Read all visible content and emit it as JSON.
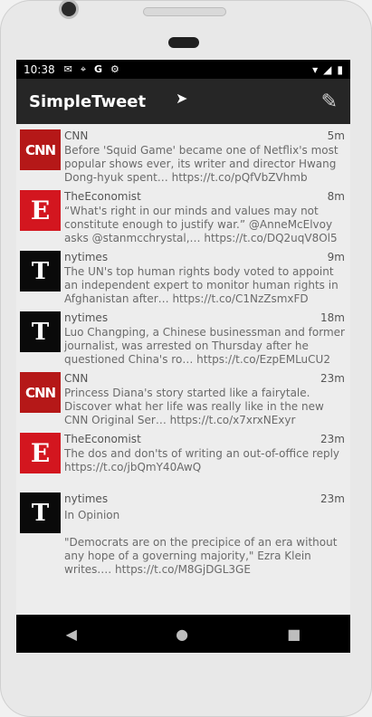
{
  "status": {
    "time": "10:38"
  },
  "appbar": {
    "title": "SimpleTweet"
  },
  "tweets": [
    {
      "user": "CNN",
      "avatar": "CNN",
      "age": "5m",
      "text": "Before 'Squid Game' became one of Netflix's most popular shows ever, its writer and director Hwang Dong-hyuk spent… https://t.co/pQfVbZVhmb"
    },
    {
      "user": "TheEconomist",
      "avatar": "E",
      "age": "8m",
      "text": "“What's right in our minds and values may not constitute enough to justify war.” @AnneMcElvoy asks @stanmcchrystal,… https://t.co/DQ2uqV8Ol5"
    },
    {
      "user": "nytimes",
      "avatar": "T",
      "age": "9m",
      "text": "The UN's top human rights body voted to appoint an independent expert to monitor human rights in Afghanistan after… https://t.co/C1NzZsmxFD"
    },
    {
      "user": "nytimes",
      "avatar": "T",
      "age": "18m",
      "text": "Luo Changping, a Chinese businessman and former journalist, was arrested on Thursday after he questioned China's ro… https://t.co/EzpEMLuCU2"
    },
    {
      "user": "CNN",
      "avatar": "CNN",
      "age": "23m",
      "text": "Princess Diana's story started like a fairytale. Discover what her life was really like in the new CNN Original Ser… https://t.co/x7xrxNExyr"
    },
    {
      "user": "TheEconomist",
      "avatar": "E",
      "age": "23m",
      "text": "The dos and don'ts of writing an out-of-office reply https://t.co/jbQmY40AwQ"
    },
    {
      "user": "nytimes",
      "avatar": "T",
      "age": "23m",
      "text": "In Opinion\n\n\"Democrats are on the precipice of an era without any hope of a governing majority,\" Ezra Klein writes.… https://t.co/M8GjDGL3GE"
    }
  ],
  "icons": {
    "status_left": [
      "gmail-icon",
      "location-icon",
      "google-icon",
      "settings-icon"
    ],
    "status_right": [
      "wifi-icon",
      "signal-icon",
      "battery-icon"
    ],
    "compose": "pencil-icon",
    "nav": [
      "back-icon",
      "home-icon",
      "recents-icon"
    ]
  }
}
